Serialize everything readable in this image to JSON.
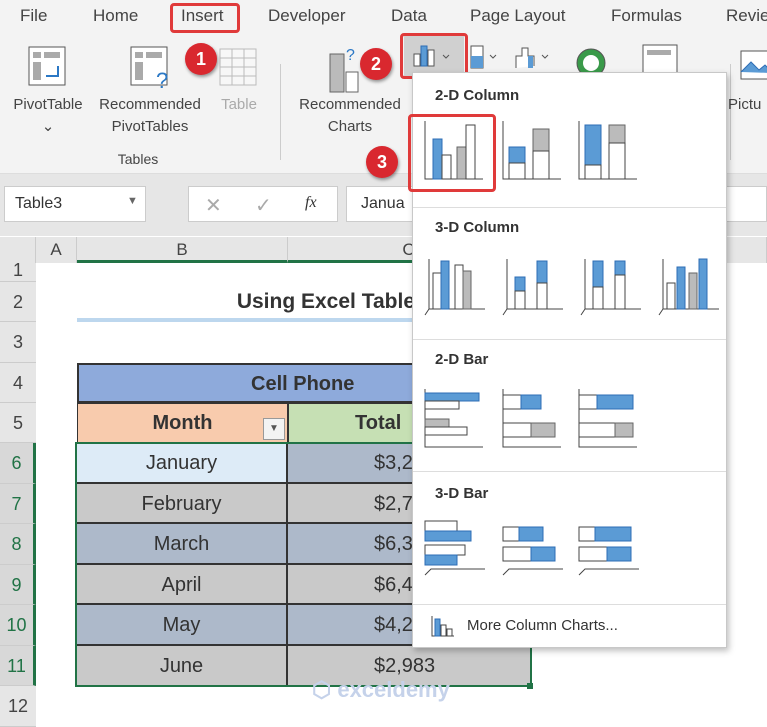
{
  "tabs": [
    "File",
    "Home",
    "Insert",
    "Developer",
    "Data",
    "Page Layout",
    "Formulas",
    "Revie"
  ],
  "ribbon": {
    "pivottable": "PivotTable",
    "recommended_pivot_1": "Recommended",
    "recommended_pivot_2": "PivotTables",
    "table": "Table",
    "group_tables": "Tables",
    "recommended_charts_1": "Recommended",
    "recommended_charts_2": "Charts",
    "pictures": "Pictu"
  },
  "badges": [
    "1",
    "2",
    "3"
  ],
  "formula_bar": {
    "name_box": "Table3",
    "fx": "fx",
    "value": "Janua"
  },
  "columns": [
    "A",
    "B",
    "C"
  ],
  "rows": [
    "1",
    "2",
    "3",
    "4",
    "5",
    "6",
    "7",
    "8",
    "9",
    "10",
    "11",
    "12"
  ],
  "sheet": {
    "title": "Using Excel Table",
    "table_header": "Cell Phone",
    "col_month": "Month",
    "col_total": "Total",
    "data": [
      {
        "month": "January",
        "total": "$3,2"
      },
      {
        "month": "February",
        "total": "$2,7"
      },
      {
        "month": "March",
        "total": "$6,3"
      },
      {
        "month": "April",
        "total": "$6,4"
      },
      {
        "month": "May",
        "total": "$4,2"
      },
      {
        "month": "June",
        "total": "$2,983"
      }
    ]
  },
  "dropdown": {
    "s1": "2-D Column",
    "s2": "3-D Column",
    "s3": "2-D Bar",
    "s4": "3-D Bar",
    "more": "More Column Charts..."
  },
  "watermark": "exceldemy",
  "colors": {
    "accent_red": "#e03a3a",
    "chart_blue": "#5b9bd5",
    "header_blue": "#8eaadb",
    "month_orange": "#f8cbad",
    "total_green": "#c6e0b4",
    "selection_green": "#217346"
  }
}
